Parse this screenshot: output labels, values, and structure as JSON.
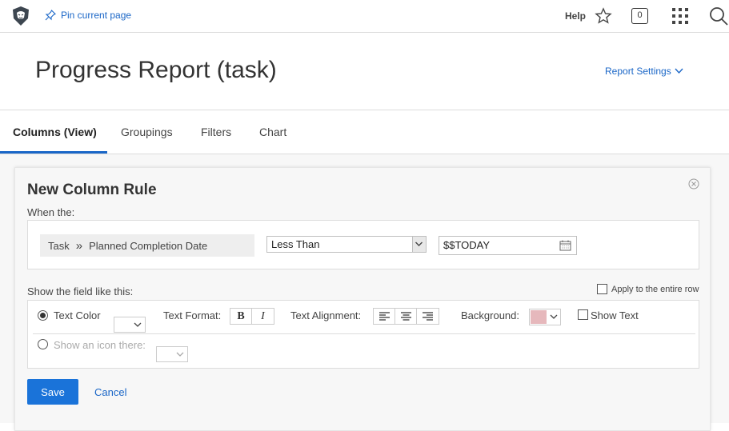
{
  "topbar": {
    "pin_label": "Pin current page",
    "help_label": "Help",
    "notification_count": "0",
    "icons": [
      "lion-logo-icon",
      "pin-icon",
      "star-icon",
      "notification-icon",
      "apps-grid-icon",
      "search-icon"
    ]
  },
  "header": {
    "title": "Progress Report (task)",
    "report_settings_label": "Report Settings"
  },
  "tabs": [
    {
      "label": "Columns (View)",
      "active": true
    },
    {
      "label": "Groupings",
      "active": false
    },
    {
      "label": "Filters",
      "active": false
    },
    {
      "label": "Chart",
      "active": false
    }
  ],
  "rule": {
    "title": "New Column Rule",
    "when_label": "When the:",
    "field": {
      "object": "Task",
      "separator": "»",
      "name": "Planned Completion Date"
    },
    "operator": "Less Than",
    "value": "$$TODAY",
    "show_label": "Show the field like this:",
    "apply_entire_row_label": "Apply to the entire row",
    "text_color_label": "Text Color",
    "text_format_label": "Text Format:",
    "bold_label": "B",
    "italic_label": "I",
    "text_alignment_label": "Text Alignment:",
    "background_label": "Background:",
    "background_color": "#e6b8bc",
    "show_text_label": "Show Text",
    "show_icon_label": "Show an icon there:",
    "save_label": "Save",
    "cancel_label": "Cancel"
  },
  "colors": {
    "accent": "#1a66c7",
    "primary_button": "#1a73d9"
  }
}
